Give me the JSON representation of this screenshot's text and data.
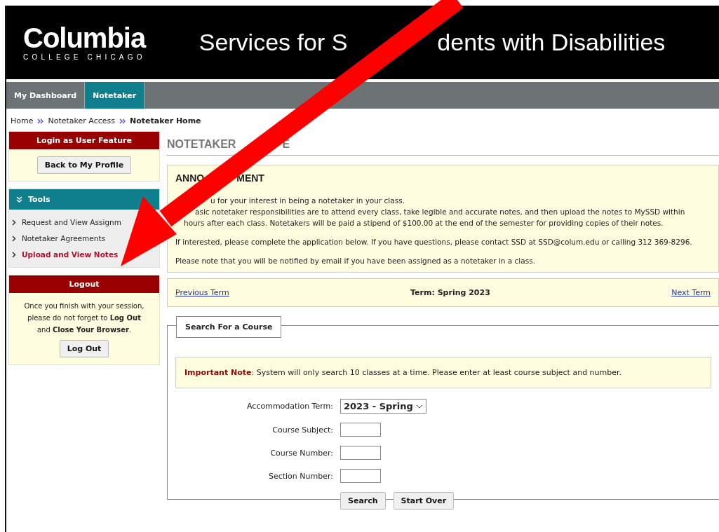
{
  "header": {
    "logo": "Columbia",
    "logo_sub": "COLLEGE CHICAGO",
    "title_before": "Services for S",
    "title_after": "dents with Disabilities"
  },
  "tabs": [
    {
      "label": "My Dashboard",
      "selected": false
    },
    {
      "label": "Notetaker",
      "selected": true
    }
  ],
  "breadcrumb": [
    {
      "label": "Home",
      "current": false
    },
    {
      "label": "Notetaker Access",
      "current": false
    },
    {
      "label": "Notetaker Home",
      "current": true
    }
  ],
  "sidebar": {
    "login_panel": {
      "title": "Login as User Feature",
      "button": "Back to My Profile"
    },
    "tools": {
      "title": "Tools",
      "items": [
        {
          "label": "Request and View Assignm",
          "selected": false
        },
        {
          "label": "Notetaker Agreements",
          "selected": false
        },
        {
          "label": "Upload and View Notes",
          "selected": true
        }
      ]
    },
    "logout_panel": {
      "title": "Logout",
      "message": "Once you finish with your session, please do not forget to **Log Out** and **Close Your Browser**.",
      "button": "Log Out"
    }
  },
  "main": {
    "heading_before": "NOTETAKER",
    "heading_after": "E",
    "announcement": {
      "title_before": "ANNO",
      "title_after": "MENT",
      "lines": [
        "u for your interest in being a notetaker in your class.",
        "asic notetaker responsibilities are to attend every class, take legible and accurate notes, and then upload the notes to MySSD within",
        "hours after each class. Notetakers will be paid a stipend of $100.00 at the end of the semester for providing copies of their notes."
      ],
      "paragraphs": [
        "If interested, please complete the application below. If you have questions, please contact SSD at SSD@colum.edu or calling 312 369-8296.",
        "Please note that you will be notified by email if you have been assigned as a notetaker in a class."
      ]
    },
    "term_bar": {
      "previous": "Previous Term",
      "term": "Term: Spring 2023",
      "next": "Next Term"
    },
    "search": {
      "legend": "Search For a Course",
      "note_label": "Important Note",
      "note_text": ": System will only search 10 classes at a time. Please enter at least course subject and number.",
      "fields": [
        {
          "kind": "select",
          "label": "Accommodation Term:",
          "value": "2023 - Spring"
        },
        {
          "kind": "text",
          "label": "Course Subject:"
        },
        {
          "kind": "text",
          "label": "Course Number:"
        },
        {
          "kind": "text",
          "label": "Section Number:"
        }
      ],
      "buttons": [
        "Search",
        "Start Over"
      ]
    }
  }
}
